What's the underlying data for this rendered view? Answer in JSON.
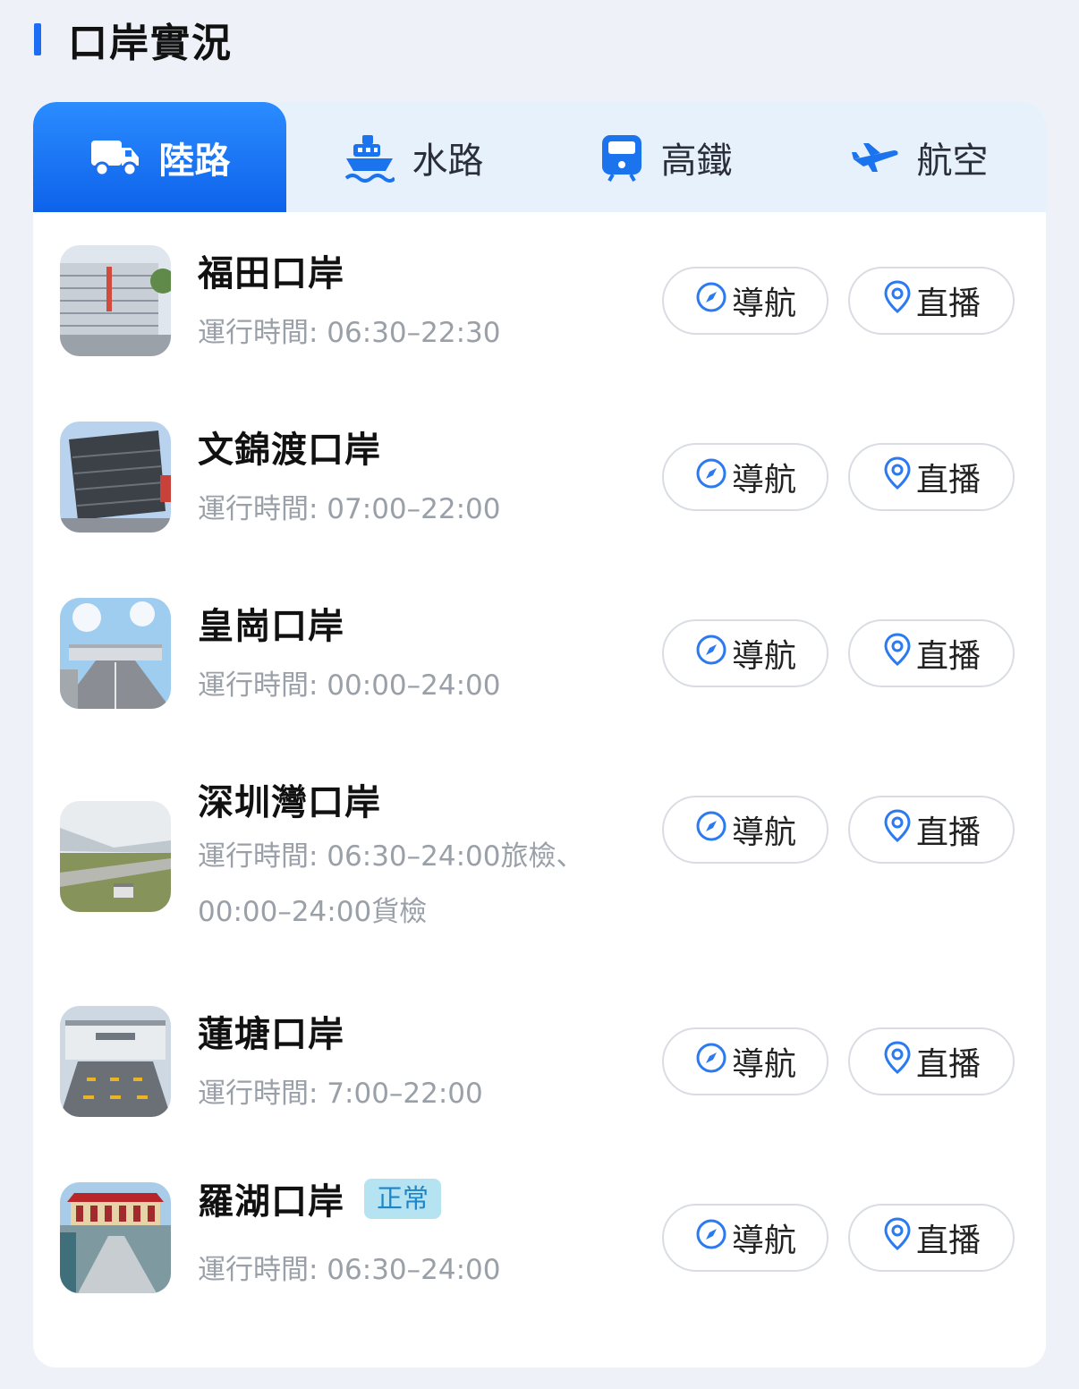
{
  "section": {
    "title": "口岸實況"
  },
  "tabs": [
    {
      "label": "陸路",
      "icon": "truck-icon",
      "active": true
    },
    {
      "label": "水路",
      "icon": "ship-icon",
      "active": false
    },
    {
      "label": "高鐵",
      "icon": "train-icon",
      "active": false
    },
    {
      "label": "航空",
      "icon": "airplane-icon",
      "active": false
    }
  ],
  "ports": [
    {
      "name": "福田口岸",
      "hours": "運行時間: 06:30–22:30",
      "badge": "",
      "nav_label": "導航",
      "live_label": "直播"
    },
    {
      "name": "文錦渡口岸",
      "hours": "運行時間: 07:00–22:00",
      "badge": "",
      "nav_label": "導航",
      "live_label": "直播"
    },
    {
      "name": "皇崗口岸",
      "hours": "運行時間: 00:00–24:00",
      "badge": "",
      "nav_label": "導航",
      "live_label": "直播"
    },
    {
      "name": "深圳灣口岸",
      "hours": "運行時間: 06:30–24:00旅檢、00:00–24:00貨檢",
      "badge": "",
      "nav_label": "導航",
      "live_label": "直播"
    },
    {
      "name": "蓮塘口岸",
      "hours": "運行時間: 7:00–22:00",
      "badge": "",
      "nav_label": "導航",
      "live_label": "直播"
    },
    {
      "name": "羅湖口岸",
      "hours": "運行時間: 06:30–24:00",
      "badge": "正常",
      "nav_label": "導航",
      "live_label": "直播"
    }
  ],
  "colors": {
    "accent": "#1b6ef3",
    "tab_active": "#0d62ea",
    "tab_bar_bg": "#e6f1fc",
    "badge_bg": "#b6e3f2",
    "badge_text": "#1d86c8",
    "hours_text": "#9aa0a8"
  }
}
